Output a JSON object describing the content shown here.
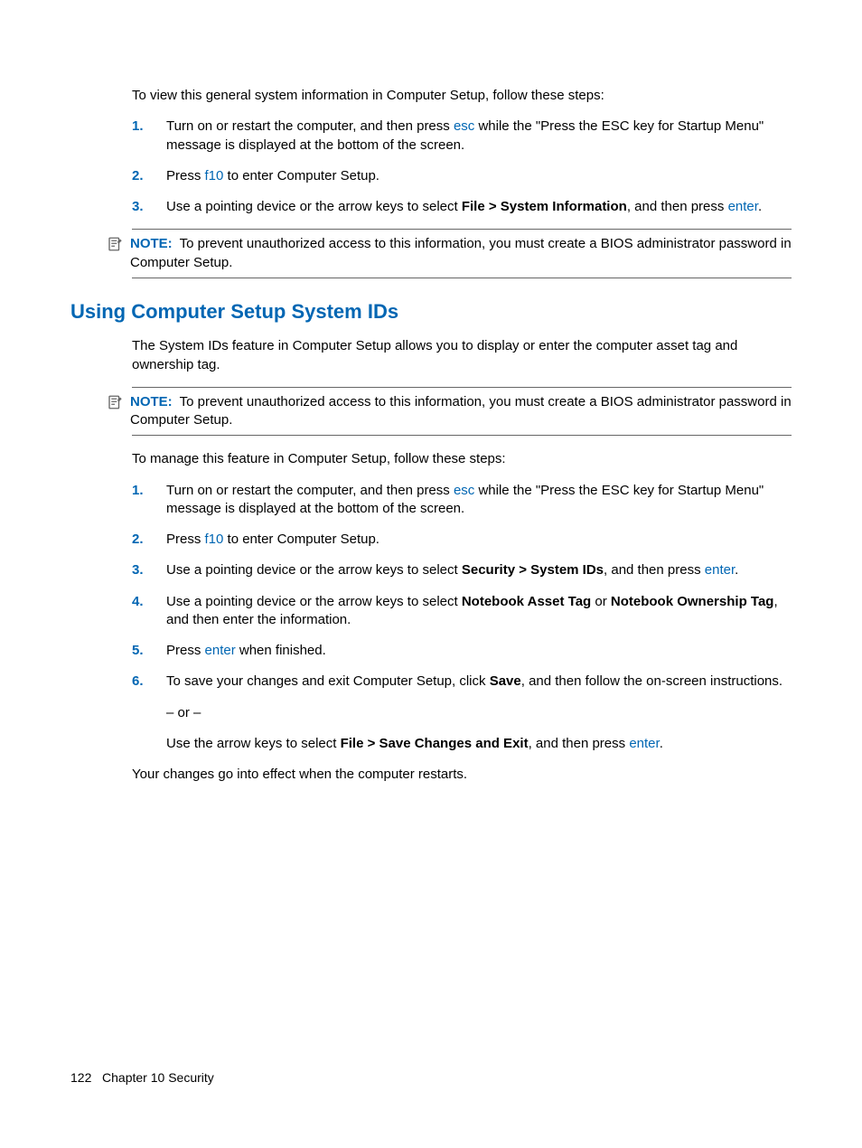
{
  "intro1": "To view this general system information in Computer Setup, follow these steps:",
  "steps1": {
    "s1": {
      "num": "1.",
      "a": "Turn on or restart the computer, and then press ",
      "key": "esc",
      "b": " while the \"Press the ESC key for Startup Menu\" message is displayed at the bottom of the screen."
    },
    "s2": {
      "num": "2.",
      "a": "Press ",
      "key": "f10",
      "b": " to enter Computer Setup."
    },
    "s3": {
      "num": "3.",
      "a": "Use a pointing device or the arrow keys to select ",
      "bold": "File > System Information",
      "b": ", and then press ",
      "key": "enter",
      "c": "."
    }
  },
  "note1": {
    "label": "NOTE:",
    "text": "To prevent unauthorized access to this information, you must create a BIOS administrator password in Computer Setup."
  },
  "heading": "Using Computer Setup System IDs",
  "intro2": "The System IDs feature in Computer Setup allows you to display or enter the computer asset tag and ownership tag.",
  "note2": {
    "label": "NOTE:",
    "text": "To prevent unauthorized access to this information, you must create a BIOS administrator password in Computer Setup."
  },
  "intro3": "To manage this feature in Computer Setup, follow these steps:",
  "steps2": {
    "s1": {
      "num": "1.",
      "a": "Turn on or restart the computer, and then press ",
      "key": "esc",
      "b": " while the \"Press the ESC key for Startup Menu\" message is displayed at the bottom of the screen."
    },
    "s2": {
      "num": "2.",
      "a": "Press ",
      "key": "f10",
      "b": " to enter Computer Setup."
    },
    "s3": {
      "num": "3.",
      "a": "Use a pointing device or the arrow keys to select ",
      "bold": "Security > System IDs",
      "b": ", and then press ",
      "key": "enter",
      "c": "."
    },
    "s4": {
      "num": "4.",
      "a": "Use a pointing device or the arrow keys to select ",
      "bold1": "Notebook Asset Tag",
      "mid": " or ",
      "bold2": "Notebook Ownership Tag",
      "b": ", and then enter the information."
    },
    "s5": {
      "num": "5.",
      "a": "Press ",
      "key": "enter",
      "b": " when finished."
    },
    "s6": {
      "num": "6.",
      "a": "To save your changes and exit Computer Setup, click ",
      "bold": "Save",
      "b": ", and then follow the on-screen instructions.",
      "or": "– or –",
      "c": "Use the arrow keys to select ",
      "bold2": "File > Save Changes and Exit",
      "d": ", and then press ",
      "key": "enter",
      "e": "."
    }
  },
  "closing": "Your changes go into effect when the computer restarts.",
  "footer": {
    "page": "122",
    "chapter": "Chapter 10   Security"
  }
}
